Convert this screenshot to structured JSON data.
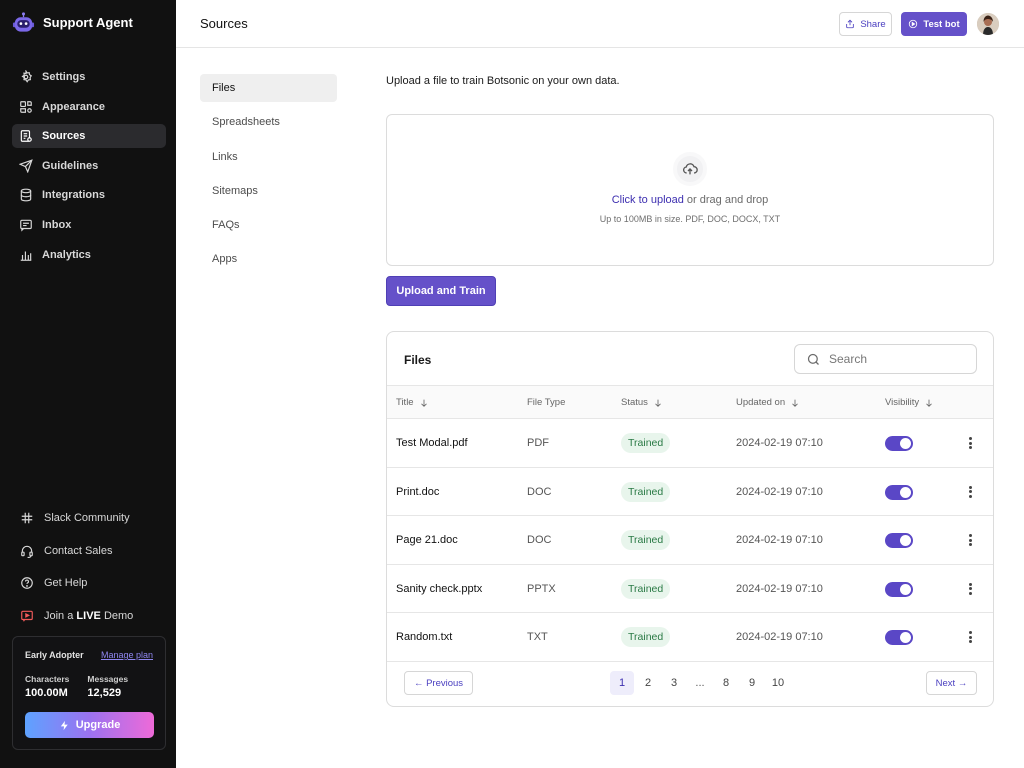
{
  "app": {
    "name": "Support Agent"
  },
  "sidebar": {
    "items": [
      {
        "label": "Settings",
        "icon": "gear-icon"
      },
      {
        "label": "Appearance",
        "icon": "palette-icon"
      },
      {
        "label": "Sources",
        "icon": "sources-icon",
        "active": true
      },
      {
        "label": "Guidelines",
        "icon": "send-icon"
      },
      {
        "label": "Integrations",
        "icon": "database-icon"
      },
      {
        "label": "Inbox",
        "icon": "inbox-icon"
      },
      {
        "label": "Analytics",
        "icon": "bar-chart-icon"
      }
    ],
    "footer_links": {
      "slack": "Slack Community",
      "contact": "Contact Sales",
      "help": "Get Help",
      "demo_prefix": "Join a",
      "demo_bold": "LIVE",
      "demo_suffix": "Demo"
    },
    "plan": {
      "name": "Early Adopter",
      "manage_label": "Manage plan",
      "characters_label": "Characters",
      "characters_value": "100.00M",
      "messages_label": "Messages",
      "messages_value": "12,529",
      "upgrade_label": "Upgrade"
    }
  },
  "header": {
    "title": "Sources",
    "share_label": "Share",
    "testbot_label": "Test bot"
  },
  "subnav": {
    "items": [
      "Files",
      "Spreadsheets",
      "Links",
      "Sitemaps",
      "FAQs",
      "Apps"
    ],
    "active": "Files"
  },
  "main": {
    "intro": "Upload a file to train Botsonic on your own data.",
    "dropzone": {
      "link": "Click to upload",
      "rest": " or drag and drop",
      "hint": "Up to 100MB in size. PDF, DOC, DOCX, TXT"
    },
    "train_label": "Upload and Train"
  },
  "table": {
    "title": "Files",
    "search_placeholder": "Search",
    "columns": [
      "Title",
      "File Type",
      "Status",
      "Updated on",
      "Visibility"
    ],
    "rows": [
      {
        "title": "Test Modal.pdf",
        "type": "PDF",
        "status": "Trained",
        "updated": "2024-02-19 07:10",
        "visible": true
      },
      {
        "title": "Print.doc",
        "type": "DOC",
        "status": "Trained",
        "updated": "2024-02-19 07:10",
        "visible": true
      },
      {
        "title": "Page 21.doc",
        "type": "DOC",
        "status": "Trained",
        "updated": "2024-02-19 07:10",
        "visible": true
      },
      {
        "title": "Sanity check.pptx",
        "type": "PPTX",
        "status": "Trained",
        "updated": "2024-02-19 07:10",
        "visible": true
      },
      {
        "title": "Random.txt",
        "type": "TXT",
        "status": "Trained",
        "updated": "2024-02-19 07:10",
        "visible": true
      }
    ],
    "pagination": {
      "prev_label": "← Previous",
      "next_label": "Next →",
      "pages": [
        "1",
        "2",
        "3",
        "...",
        "8",
        "9",
        "10"
      ],
      "current": "1"
    }
  },
  "colors": {
    "accent": "#6551c9",
    "sidebar_bg": "#111111",
    "badge_bg": "#e8f5ec",
    "badge_text": "#2a7a45"
  }
}
